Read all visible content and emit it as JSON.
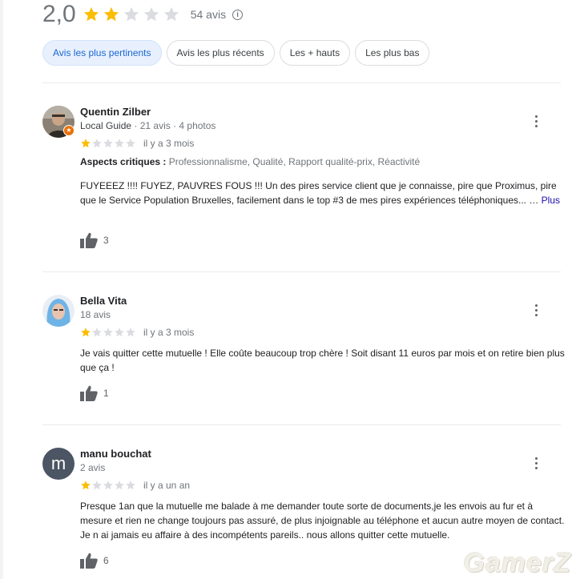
{
  "summary": {
    "score": "2,0",
    "rating": 2,
    "max_rating": 5,
    "count": "54 avis"
  },
  "sort_chips": [
    {
      "label": "Avis les plus pertinents",
      "active": true
    },
    {
      "label": "Avis les plus récents",
      "active": false
    },
    {
      "label": "Les + hauts",
      "active": false
    },
    {
      "label": "Les plus bas",
      "active": false
    }
  ],
  "reviews": [
    {
      "name": "Quentin Zilber",
      "local_guide": "Local Guide",
      "meta": " · 21 avis · 4 photos",
      "rating": 1,
      "date": "il y a 3 mois",
      "aspects_label": "Aspects critiques :",
      "aspects": " Professionnalisme, Qualité, Rapport qualité-prix, Réactivité",
      "text": "FUYEEEZ !!!! FUYEZ, PAUVRES FOUS !!! Un des pires service client que je connaisse, pire que Proximus, pire que le Service Population Bruxelles, facilement dans le top #3 de mes pires expériences téléphoniques... … ",
      "more": "Plus",
      "likes": "3"
    },
    {
      "name": "Bella Vita",
      "meta": "18 avis",
      "rating": 1,
      "date": "il y a 3 mois",
      "text": "Je vais quitter cette mutuelle ! Elle coûte beaucoup trop chère ! Soit disant 11 euros par mois et on retire bien plus que ça !",
      "likes": "1"
    },
    {
      "name": "manu bouchat",
      "avatar_letter": "m",
      "meta": "2 avis",
      "rating": 1,
      "date": "il y a un an",
      "text": "Presque 1an que la mutuelle me balade à me demander toute sorte de documents,je les envois au fur et à mesure et rien ne change toujours pas assuré, de plus injoignable au téléphone et aucun autre moyen de contact. Je n ai jamais eu affaire à des incompétents pareils.. nous allons quitter cette mutuelle.",
      "likes": "6"
    }
  ],
  "watermark": "GamerZ",
  "colors": {
    "star_filled": "#fbbc04",
    "star_empty": "#dadce0",
    "chip_active_bg": "#e8f0fe",
    "link": "#1a0dab"
  }
}
